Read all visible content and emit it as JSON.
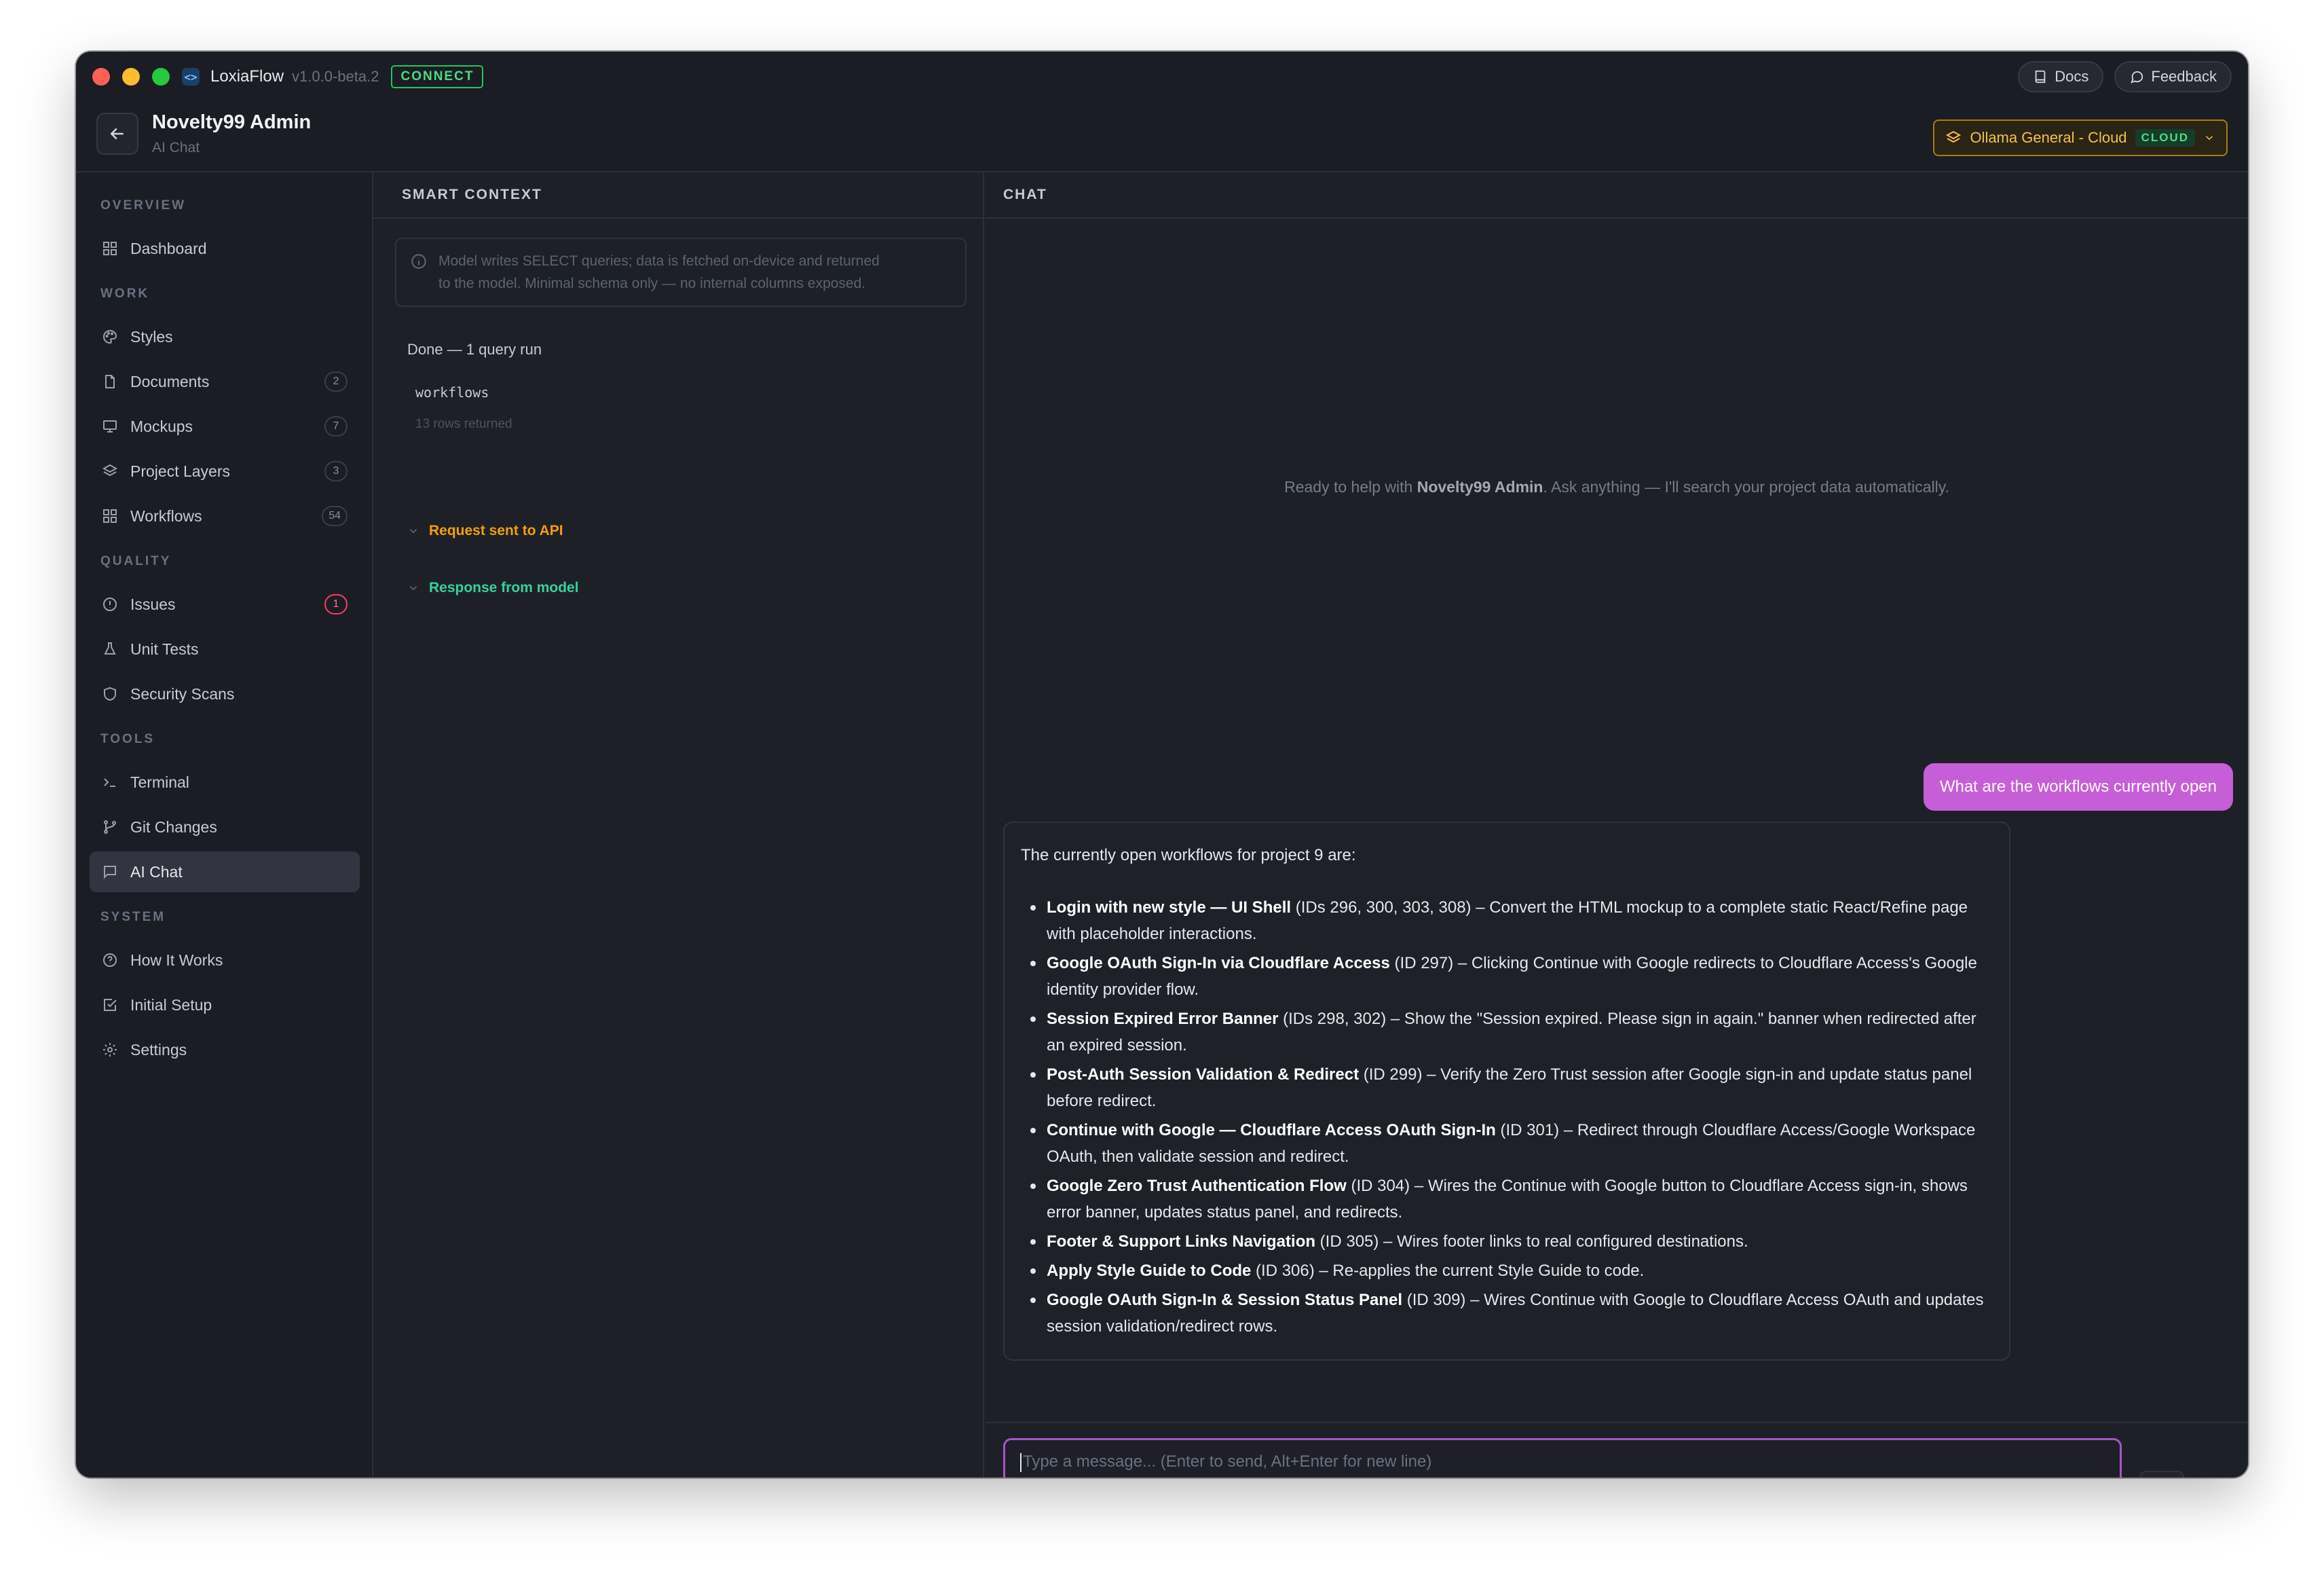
{
  "titlebar": {
    "app_icon": "<>",
    "app_name": "LoxiaFlow",
    "version": "v1.0.0-beta.2",
    "connect_label": "CONNECT",
    "docs_label": "Docs",
    "feedback_label": "Feedback"
  },
  "header": {
    "title": "Novelty99 Admin",
    "subtitle": "AI Chat",
    "model_label": "Ollama General - Cloud",
    "model_badge": "CLOUD"
  },
  "sidebar": {
    "sections": {
      "overview": "OVERVIEW",
      "work": "WORK",
      "quality": "QUALITY",
      "tools": "TOOLS",
      "system": "SYSTEM"
    },
    "items": [
      {
        "label": "Dashboard",
        "icon": "grid-icon"
      },
      {
        "label": "Styles",
        "icon": "palette-icon"
      },
      {
        "label": "Documents",
        "icon": "file-icon",
        "count": "2"
      },
      {
        "label": "Mockups",
        "icon": "monitor-icon",
        "count": "7"
      },
      {
        "label": "Project Layers",
        "icon": "layers-icon",
        "count": "3"
      },
      {
        "label": "Workflows",
        "icon": "grid-icon",
        "count": "54"
      },
      {
        "label": "Issues",
        "icon": "alert-circle-icon",
        "count": "1"
      },
      {
        "label": "Unit Tests",
        "icon": "flask-icon"
      },
      {
        "label": "Security Scans",
        "icon": "shield-icon"
      },
      {
        "label": "Terminal",
        "icon": "terminal-icon"
      },
      {
        "label": "Git Changes",
        "icon": "git-branch-icon"
      },
      {
        "label": "AI Chat",
        "icon": "message-icon",
        "active": true
      },
      {
        "label": "How It Works",
        "icon": "help-circle-icon"
      },
      {
        "label": "Initial Setup",
        "icon": "check-square-icon"
      },
      {
        "label": "Settings",
        "icon": "sun-gear-icon"
      }
    ]
  },
  "context": {
    "heading": "SMART CONTEXT",
    "info_line1": "Model writes SELECT queries; data is fetched on-device and returned",
    "info_line2": "to the model. Minimal schema only — no internal columns exposed.",
    "status": "Done — 1 query run",
    "table": "workflows",
    "rows": "13 rows returned",
    "request_label": "Request sent to API",
    "response_label": "Response from model"
  },
  "chat": {
    "heading": "CHAT",
    "empty_prefix": "Ready to help with ",
    "empty_project": "Novelty99 Admin",
    "empty_suffix": ". Ask anything — I'll search your project data automatically.",
    "user_message": "What are the workflows currently open",
    "assistant_intro": "The currently open workflows for project 9 are:",
    "assistant_items": [
      {
        "title": "Login with new style — UI Shell",
        "detail": " (IDs 296, 300, 303, 308) – Convert the HTML mockup to a complete static React/Refine page with placeholder interactions."
      },
      {
        "title": "Google OAuth Sign-In via Cloudflare Access",
        "detail": " (ID 297) – Clicking Continue with Google redirects to Cloudflare Access's Google identity provider flow."
      },
      {
        "title": "Session Expired Error Banner",
        "detail": " (IDs 298, 302) – Show the \"Session expired. Please sign in again.\" banner when redirected after an expired session."
      },
      {
        "title": "Post-Auth Session Validation & Redirect",
        "detail": " (ID 299) – Verify the Zero Trust session after Google sign-in and update status panel before redirect."
      },
      {
        "title": "Continue with Google — Cloudflare Access OAuth Sign-In",
        "detail": " (ID 301) – Redirect through Cloudflare Access/Google Workspace OAuth, then validate session and redirect."
      },
      {
        "title": "Google Zero Trust Authentication Flow",
        "detail": " (ID 304) – Wires the Continue with Google button to Cloudflare Access sign-in, shows error banner, updates status panel, and redirects."
      },
      {
        "title": "Footer & Support Links Navigation",
        "detail": " (ID 305) – Wires footer links to real configured destinations."
      },
      {
        "title": "Apply Style Guide to Code",
        "detail": " (ID 306) – Re-applies the current Style Guide to code."
      },
      {
        "title": "Google OAuth Sign-In & Session Status Panel",
        "detail": " (ID 309) – Wires Continue with Google to Cloudflare Access OAuth and updates session validation/redirect rows."
      }
    ],
    "input_placeholder": "Type a message... (Enter to send, Alt+Enter for new line)"
  },
  "colors": {
    "accent": "#c65ed8",
    "connect_green": "#22c55e",
    "model_amber": "#f5c14a",
    "request_orange": "#f59e0b",
    "response_green": "#34d399",
    "issue_red": "#f43f5e"
  }
}
